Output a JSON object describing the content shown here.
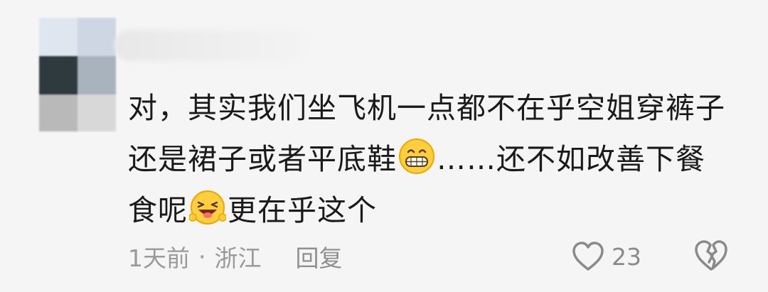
{
  "comment": {
    "text_part1": "对，其实我们坐飞机一点都不在乎空姐穿裤子还是裙子或者平底鞋",
    "text_part2": "……还不如改善下餐食呢",
    "text_part3": "更在乎这个",
    "emoji1": "grinning-face-emoji",
    "emoji2": "winking-face-tongue-emoji"
  },
  "meta": {
    "time": "1天前",
    "separator": "·",
    "location": "浙江",
    "reply_label": "回复"
  },
  "actions": {
    "like_count": "23",
    "like_icon": "heart-outline-icon",
    "dislike_icon": "broken-heart-icon"
  },
  "colors": {
    "background": "#f5f5f5",
    "text": "#1a1a1a",
    "meta_text": "#9a9a9a"
  }
}
